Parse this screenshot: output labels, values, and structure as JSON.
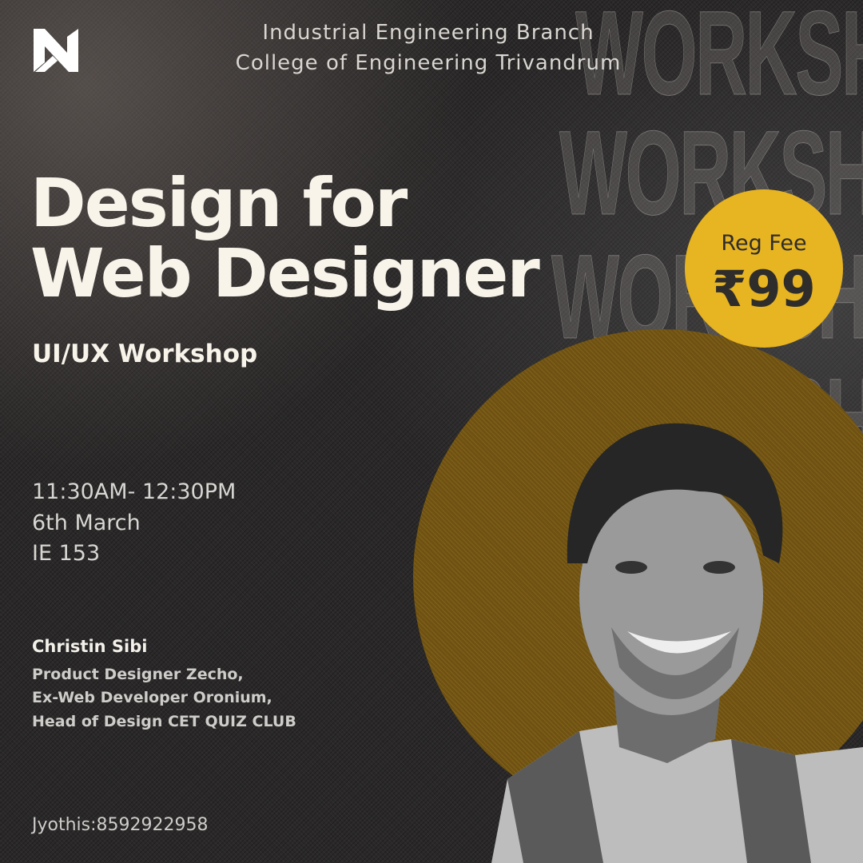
{
  "watermark": "WORKSHOP",
  "header": {
    "line1": "Industrial Engineering Branch",
    "line2": "College of Engineering Trivandrum"
  },
  "title": {
    "line1": "Design for",
    "line2": "Web Designer",
    "subtitle": "UI/UX Workshop"
  },
  "event": {
    "time": "11:30AM- 12:30PM",
    "date": "6th March",
    "venue": "IE 153"
  },
  "speaker": {
    "name": "Christin Sibi",
    "roles": [
      "Product Designer Zecho,",
      "Ex-Web Developer Oronium,",
      "Head of Design CET QUIZ CLUB"
    ]
  },
  "contact": "Jyothis:8592922958",
  "badge": {
    "label": "Reg Fee",
    "value": "₹99"
  },
  "colors": {
    "background": "#2a2828",
    "accent": "#e7b422",
    "circle": "#6f5213",
    "text": "#f8f4ea"
  }
}
